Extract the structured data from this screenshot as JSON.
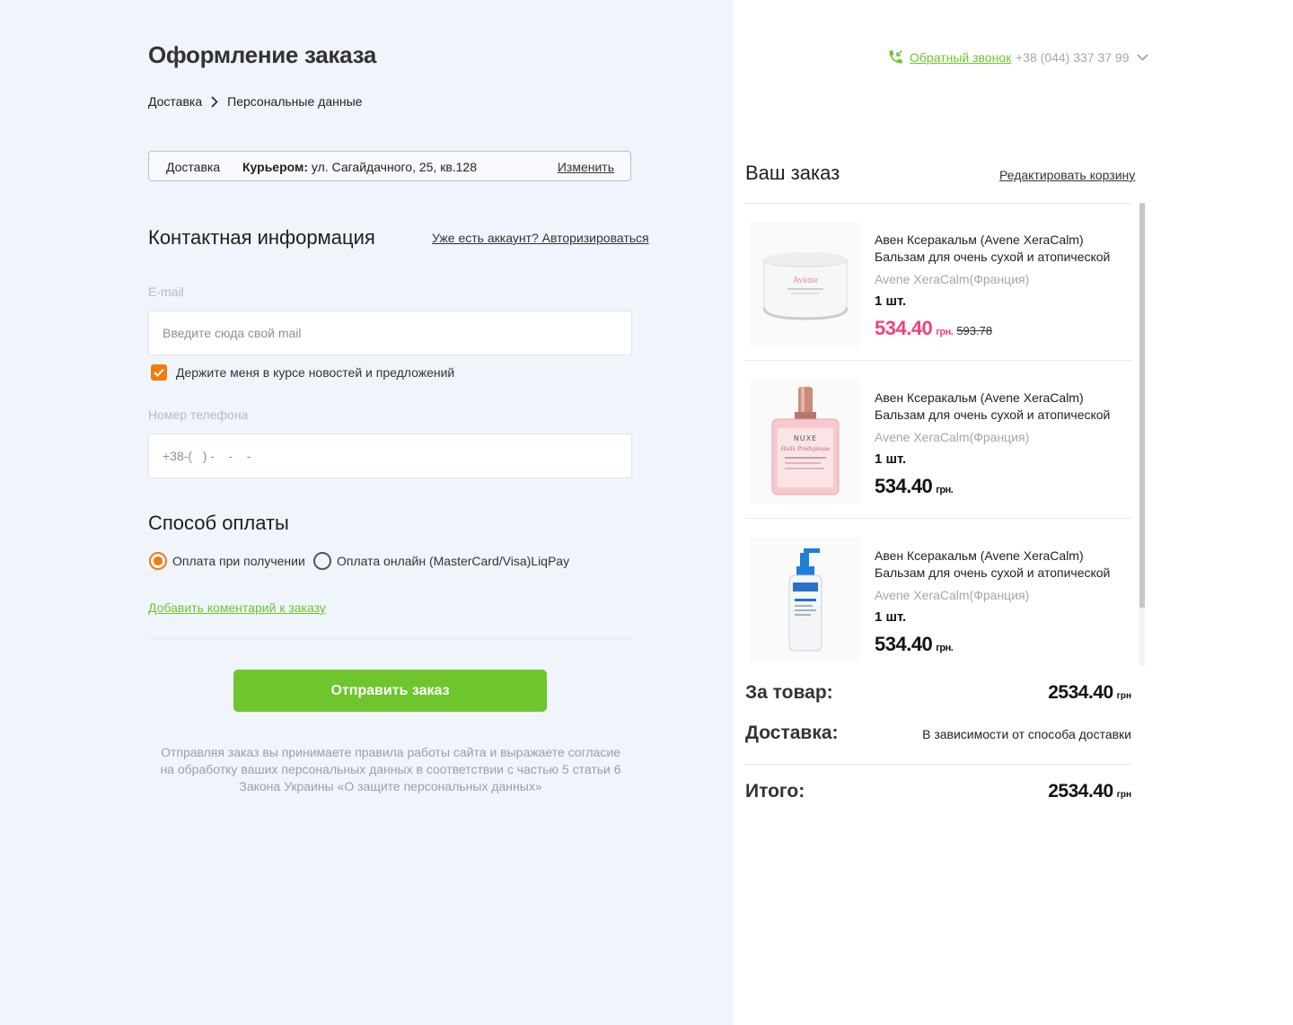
{
  "header": {
    "title": "Оформление заказа",
    "breadcrumb": [
      "Доставка",
      "Персональные данные"
    ]
  },
  "delivery_summary": {
    "label": "Доставка",
    "method": "Курьером:",
    "address": " ул. Сагайдачного, 25, кв.128",
    "change_link": "Изменить"
  },
  "contact": {
    "title": "Контактная информация",
    "login_link": "Уже есть аккаунт? Авторизироваться",
    "email_label": "E-mail",
    "email_placeholder": "Введите сюда свой mail",
    "email_value": "",
    "newsletter_label": "Держите меня в курсе новостей и предложений",
    "newsletter_checked": true,
    "phone_label": "Номер телефона",
    "phone_placeholder": "+38-(   ) -    -    -",
    "phone_value": ""
  },
  "payment": {
    "title": "Способ оплаты",
    "options": [
      {
        "label": "Оплата при получении",
        "selected": true
      },
      {
        "label": "Оплата онлайн (MasterCard/Visa)LiqPay",
        "selected": false
      }
    ]
  },
  "comment_link": "Добавить коментарий к заказу",
  "submit_label": "Отправить заказ",
  "disclaimer": "Отправляя заказ вы принимаете правила работы сайта и выражаете согласие на обработку ваших персональных данных в соответствии с частью 5 статьи 6 Закона Украины «О защите персональных данных»",
  "topbar": {
    "callback_icon": "phone-callback-icon",
    "callback_label": "Обратный звонок",
    "phone": "+38 (044) 337 37 99"
  },
  "order": {
    "title": "Ваш заказ",
    "edit_link": "Редактировать корзину",
    "items": [
      {
        "name": "Авен Ксеракальм (Avene XeraCalm) Бальзам для очень сухой и атопической",
        "brand": "Avene XeraCalm(Франция)",
        "qty": "1 шт.",
        "price": "534.40",
        "currency": "грн.",
        "old_price": "593.78",
        "on_sale": true,
        "image": "cream-jar-image"
      },
      {
        "name": "Авен Ксеракальм (Avene XeraCalm) Бальзам для очень сухой и атопической",
        "brand": "Avene XeraCalm(Франция)",
        "qty": "1 шт.",
        "price": "534.40",
        "currency": "грн.",
        "old_price": "",
        "on_sale": false,
        "image": "oil-bottle-image"
      },
      {
        "name": "Авен Ксеракальм (Avene XeraCalm) Бальзам для очень сухой и атопической",
        "brand": "Avene XeraCalm(Франция)",
        "qty": "1 шт.",
        "price": "534.40",
        "currency": "грн.",
        "old_price": "",
        "on_sale": false,
        "image": "pump-bottle-image"
      }
    ],
    "subtotal_label": "За товар:",
    "subtotal_value": "2534.40",
    "subtotal_currency": "грн",
    "delivery_label": "Доставка:",
    "delivery_value": "В зависимости от способа доставки",
    "total_label": "Итого:",
    "total_value": "2534.40",
    "total_currency": "грн"
  },
  "colors": {
    "accent_green": "#6ec62c",
    "accent_orange": "#f07b0f",
    "sale_pink": "#f0427a",
    "left_bg": "#f0f4fb"
  }
}
